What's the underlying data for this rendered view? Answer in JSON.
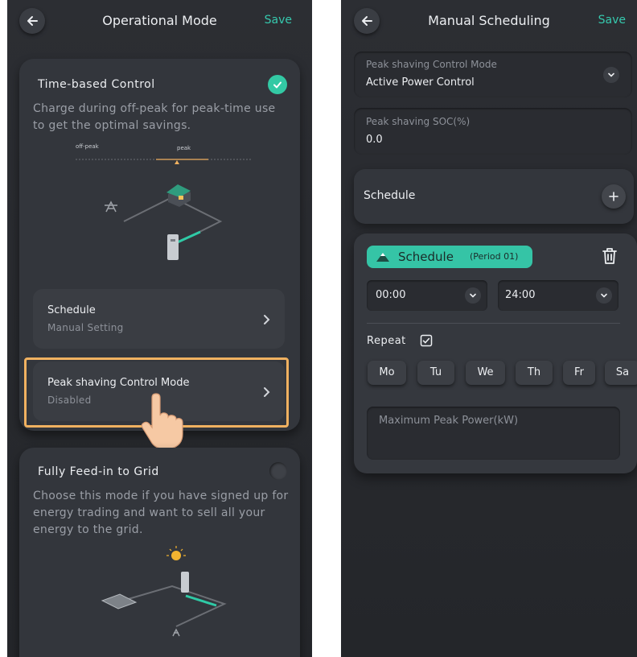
{
  "left": {
    "title": "Operational Mode",
    "save_label": "Save",
    "time_card": {
      "title": "Time-based Control",
      "description": "Charge during off-peak for peak-time use to get the optimal savings.",
      "offpeak_label": "off-peak",
      "peak_label": "peak"
    },
    "schedule_item": {
      "label": "Schedule",
      "sub": "Manual Setting"
    },
    "peak_item": {
      "label": "Peak shaving Control Mode",
      "sub": "Disabled"
    },
    "feed_card": {
      "title": "Fully Feed-in to Grid",
      "description": "Choose this mode if you have signed up for energy trading and want to sell all your energy to the grid."
    }
  },
  "right": {
    "title": "Manual Scheduling",
    "save_label": "Save",
    "mode_field": {
      "label": "Peak shaving Control Mode",
      "value": "Active Power Control"
    },
    "soc_field": {
      "label": "Peak shaving SOC(%)",
      "value": "0.0"
    },
    "schedule_header": "Schedule",
    "period": {
      "tag_label": "Schedule",
      "tag_period": "(Period 01)",
      "start_time": "00:00",
      "end_time": "24:00",
      "repeat_label": "Repeat",
      "days": [
        "Mo",
        "Tu",
        "We",
        "Th",
        "Fr",
        "Sa"
      ],
      "max_power_placeholder": "Maximum Peak Power(kW)"
    }
  },
  "colors": {
    "accent": "#36c9ae",
    "highlight": "#f0b160",
    "background": "#2c2e33"
  }
}
